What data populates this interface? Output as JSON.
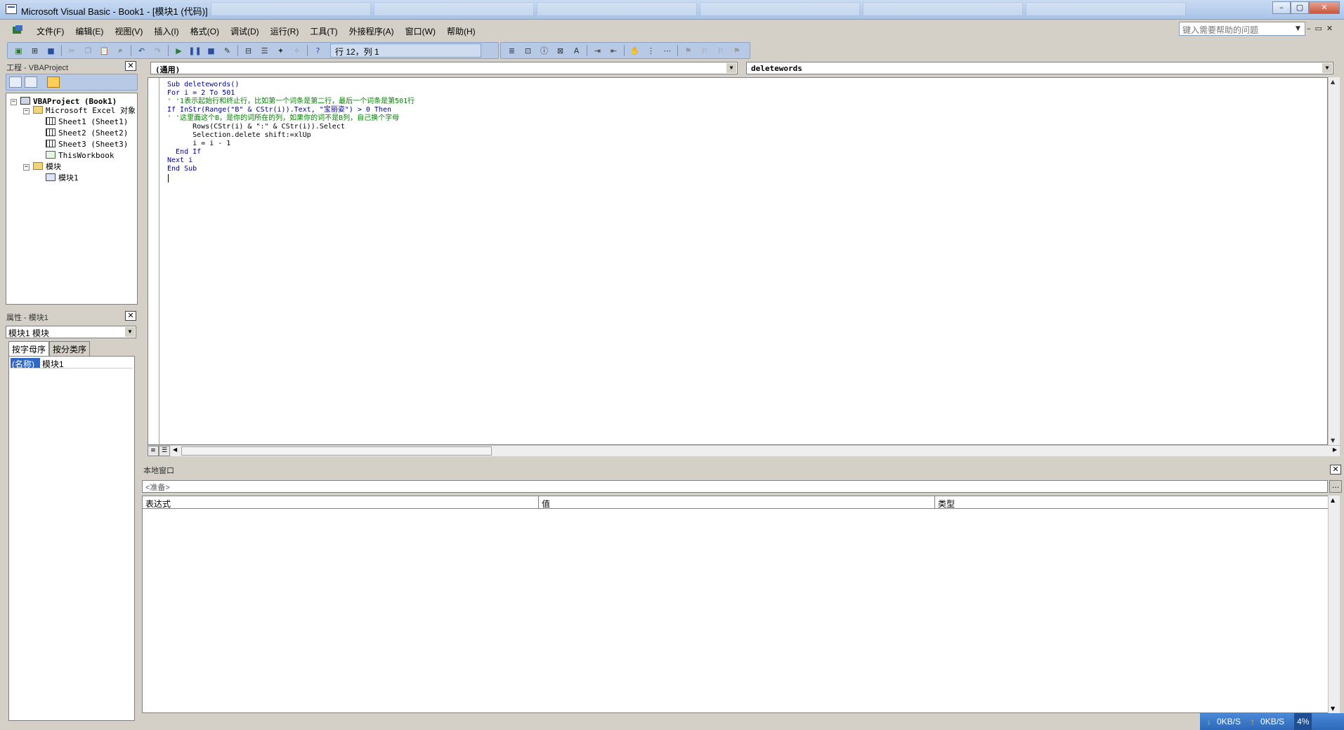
{
  "window": {
    "title": "Microsoft Visual Basic - Book1 - [模块1 (代码)]",
    "buttons": {
      "minimize": "–",
      "restore": "▢",
      "close": "✕"
    }
  },
  "menubar": {
    "items": [
      "文件(F)",
      "编辑(E)",
      "视图(V)",
      "插入(I)",
      "格式(O)",
      "调试(D)",
      "运行(R)",
      "工具(T)",
      "外接程序(A)",
      "窗口(W)",
      "帮助(H)"
    ],
    "help_placeholder": "键入需要帮助的问题",
    "mdi": {
      "minimize": "–",
      "restore": "▭",
      "close": "✕"
    }
  },
  "toolbar": {
    "cursor_position": "行 12，列 1"
  },
  "project": {
    "title": "工程 - VBAProject",
    "tree": {
      "root": "VBAProject (Book1)",
      "excel_objects": "Microsoft Excel 对象",
      "sheets": [
        "Sheet1 (Sheet1)",
        "Sheet2 (Sheet2)",
        "Sheet3 (Sheet3)"
      ],
      "workbook": "ThisWorkbook",
      "modules_folder": "模块",
      "module": "模块1"
    }
  },
  "properties": {
    "title": "属性 - 模块1",
    "selected_object": "模块1 模块",
    "tabs": [
      "按字母序",
      "按分类序"
    ],
    "rows": [
      {
        "key": "(名称)",
        "value": "模块1"
      }
    ]
  },
  "code_window": {
    "object_combo": "(通用)",
    "procedure_combo": "deletewords",
    "lines": [
      [
        {
          "t": "Sub deletewords()",
          "c": "kw"
        }
      ],
      [
        {
          "t": "For i = 2 To 501",
          "c": "kw"
        }
      ],
      [
        {
          "t": "' '1表示起始行和终止行，比如第一个词条是第二行，最后一个词条是第501行",
          "c": "cm"
        }
      ],
      [
        {
          "t": "If InStr(Range(\"B\" & CStr(i)).Text, \"宝丽姿\") > 0 Then",
          "c": "kw"
        }
      ],
      [
        {
          "t": "' '这里面这个B，是你的词所在的列，如果你的词不是B列，自己换个字母",
          "c": "cm"
        }
      ],
      [
        {
          "t": "      Rows(CStr(i) & \":\" & CStr(i)).Select",
          "c": "tx"
        }
      ],
      [
        {
          "t": "      Selection.delete shift:=xlUp",
          "c": "tx"
        }
      ],
      [
        {
          "t": "      i = i - 1",
          "c": "tx"
        }
      ],
      [
        {
          "t": "  End If",
          "c": "kw"
        }
      ],
      [
        {
          "t": "Next i",
          "c": "kw"
        }
      ],
      [
        {
          "t": "End Sub",
          "c": "kw"
        }
      ]
    ]
  },
  "locals": {
    "title": "本地窗口",
    "status": "<准备>",
    "dots": "...",
    "columns": [
      "表达式",
      "值",
      "类型"
    ]
  },
  "netspeed": {
    "down": "0KB/S",
    "up": "0KB/S",
    "percent": "4%"
  }
}
